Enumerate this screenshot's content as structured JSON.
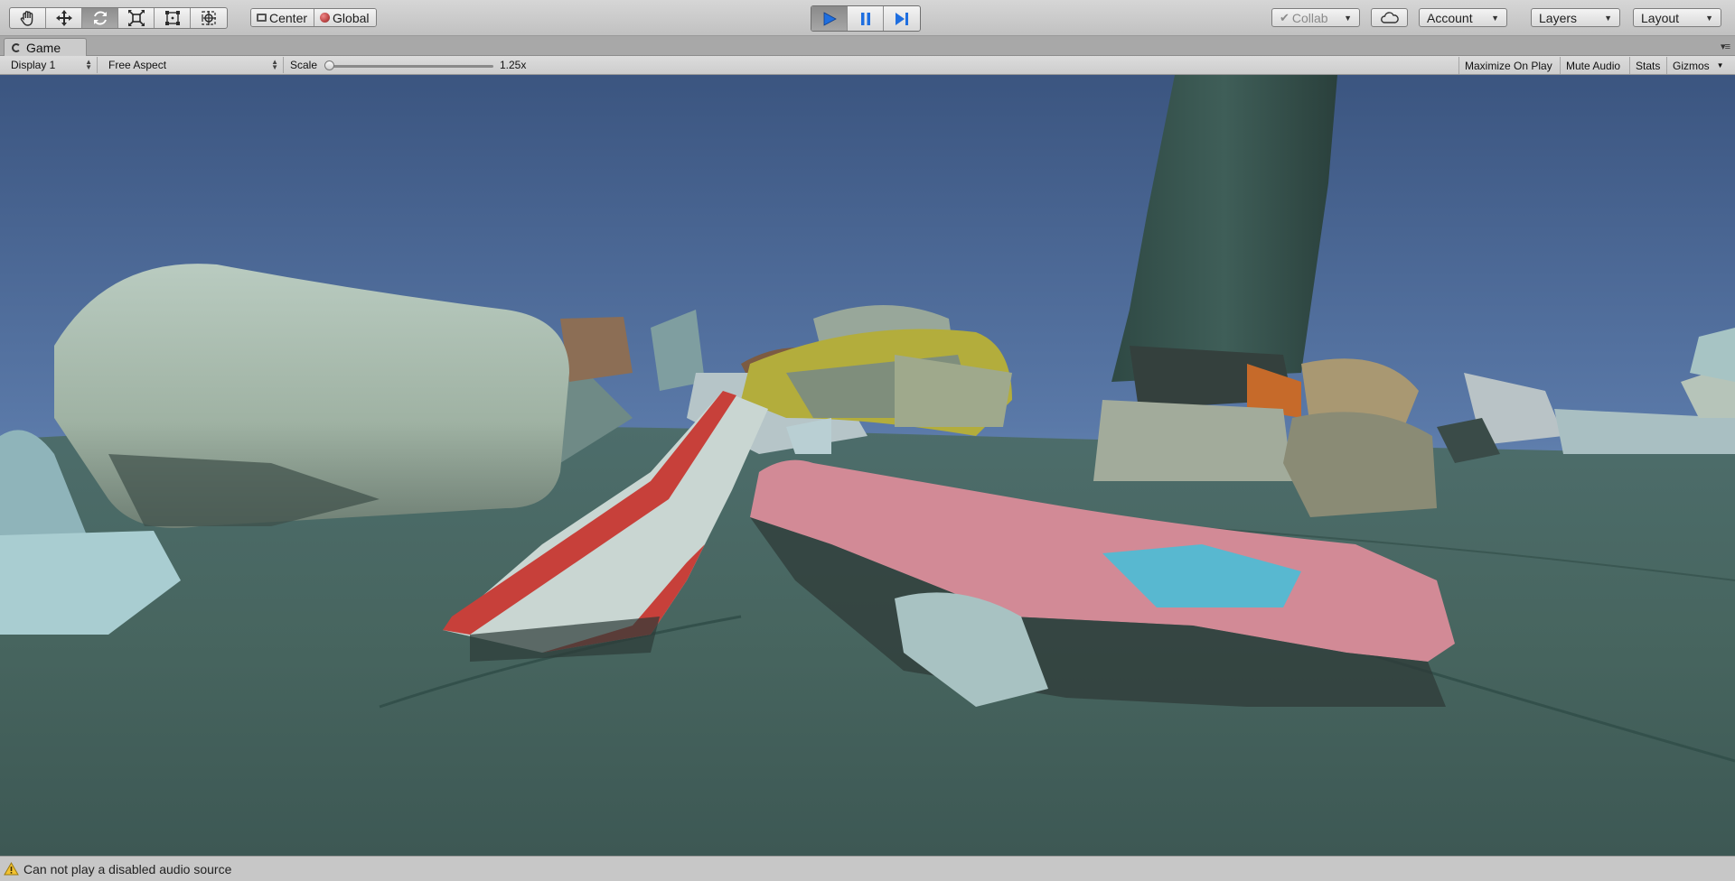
{
  "toolbar": {
    "tools": [
      "hand-tool",
      "move-tool",
      "rotate-tool",
      "scale-tool",
      "rect-tool",
      "transform-tool"
    ],
    "active_tool": "rotate-tool",
    "pivot_mode": "Center",
    "pivot_rotation": "Global",
    "collab": "Collab",
    "account": "Account",
    "layers": "Layers",
    "layout": "Layout",
    "play_active": true
  },
  "game_tab": {
    "title": "Game"
  },
  "game_view": {
    "display": "Display 1",
    "aspect": "Free Aspect",
    "scale_label": "Scale",
    "scale_value": "1.25x",
    "scale_fraction": 0.0,
    "maximize_on_play": "Maximize On Play",
    "mute_audio": "Mute Audio",
    "stats": "Stats",
    "gizmos": "Gizmos"
  },
  "viewport": {
    "sky_color": "#3e5d84",
    "ground_color": "#4a6b6a"
  },
  "status": {
    "message": "Can not play a disabled audio source"
  }
}
